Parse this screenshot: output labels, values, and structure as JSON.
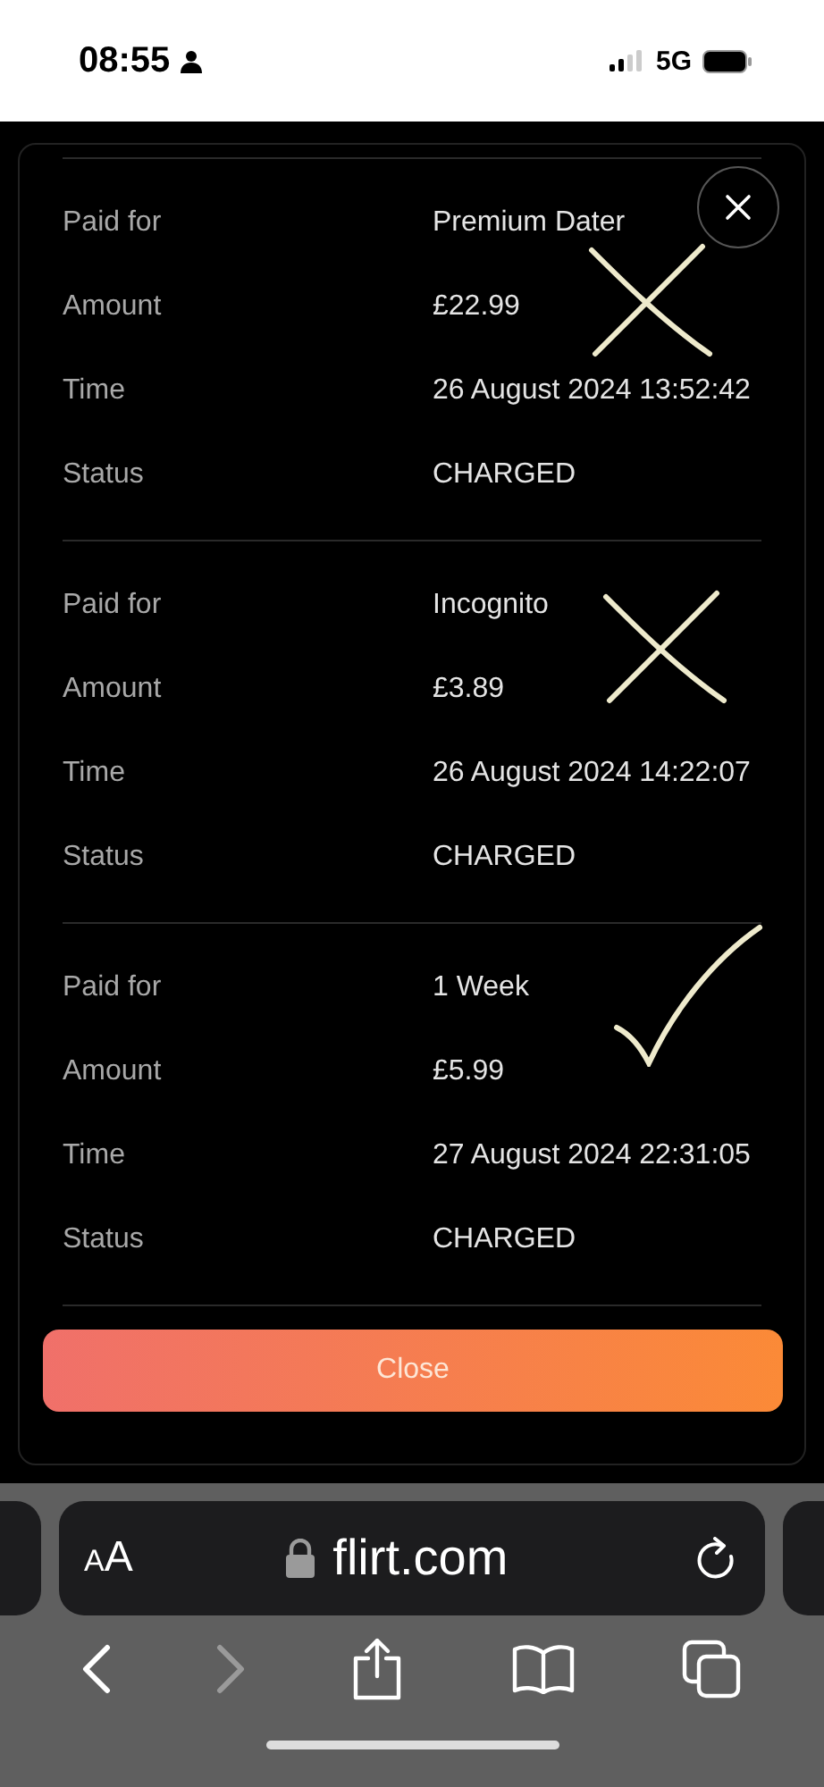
{
  "status_bar": {
    "time": "08:55",
    "network": "5G"
  },
  "payments": [
    {
      "kind": "cross",
      "fields": [
        {
          "label": "Paid for",
          "value": "Premium Dater"
        },
        {
          "label": "Amount",
          "value": "£22.99"
        },
        {
          "label": "Time",
          "value": "26 August 2024 13:52:42"
        },
        {
          "label": "Status",
          "value": "CHARGED"
        }
      ]
    },
    {
      "kind": "cross",
      "fields": [
        {
          "label": "Paid for",
          "value": "Incognito"
        },
        {
          "label": "Amount",
          "value": "£3.89"
        },
        {
          "label": "Time",
          "value": "26 August 2024 14:22:07"
        },
        {
          "label": "Status",
          "value": "CHARGED"
        }
      ]
    },
    {
      "kind": "check",
      "fields": [
        {
          "label": "Paid for",
          "value": "1 Week"
        },
        {
          "label": "Amount",
          "value": "£5.99"
        },
        {
          "label": "Time",
          "value": "27 August 2024 22:31:05"
        },
        {
          "label": "Status",
          "value": "CHARGED"
        }
      ]
    }
  ],
  "close_button": "Close",
  "browser": {
    "text_size_button": "AA",
    "url": "flirt.com"
  }
}
